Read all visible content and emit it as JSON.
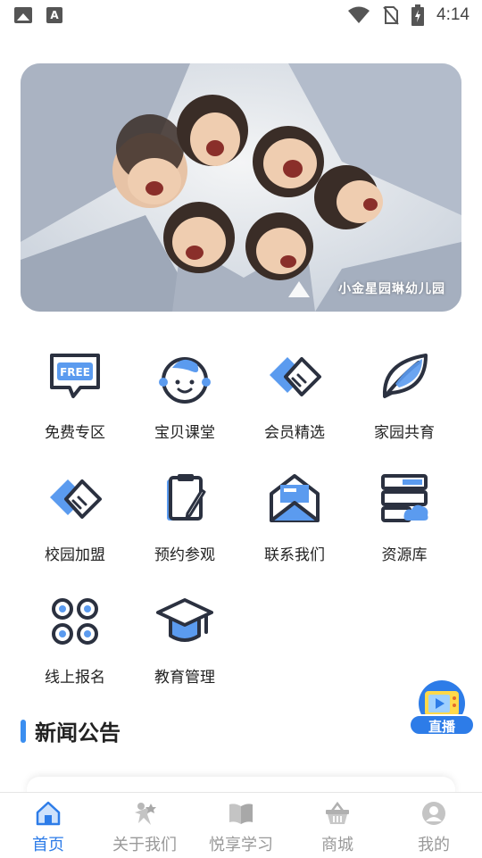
{
  "status_bar": {
    "time": "4:14",
    "left_icons": [
      "image-icon",
      "font-a-icon"
    ],
    "right_icons": [
      "wifi-icon",
      "no-sim-icon",
      "battery-charging-icon"
    ]
  },
  "banner": {
    "caption": "小金星园琳幼儿园"
  },
  "grid": [
    {
      "label": "免费专区",
      "icon": "free-badge-icon",
      "badge": "FREE"
    },
    {
      "label": "宝贝课堂",
      "icon": "baby-face-icon"
    },
    {
      "label": "会员精选",
      "icon": "handshake-icon"
    },
    {
      "label": "家园共育",
      "icon": "leaf-icon"
    },
    {
      "label": "校园加盟",
      "icon": "handshake-icon"
    },
    {
      "label": "预约参观",
      "icon": "clipboard-pen-icon"
    },
    {
      "label": "联系我们",
      "icon": "envelope-icon"
    },
    {
      "label": "资源库",
      "icon": "cloud-server-icon"
    },
    {
      "label": "线上报名",
      "icon": "apps-grid-icon"
    },
    {
      "label": "教育管理",
      "icon": "graduation-cap-icon"
    }
  ],
  "news": {
    "title": "新闻公告"
  },
  "live": {
    "label": "直播",
    "icon": "tv-play-icon"
  },
  "tabbar": [
    {
      "label": "首页",
      "icon": "home-icon",
      "active": true
    },
    {
      "label": "关于我们",
      "icon": "star-person-icon",
      "active": false
    },
    {
      "label": "悦享学习",
      "icon": "book-icon",
      "active": false
    },
    {
      "label": "商城",
      "icon": "basket-icon",
      "active": false
    },
    {
      "label": "我的",
      "icon": "user-icon",
      "active": false
    }
  ],
  "colors": {
    "accent": "#2d7ce8",
    "icon_dark": "#2b3140",
    "icon_blue": "#5b9bef",
    "tab_inactive": "#999999"
  }
}
